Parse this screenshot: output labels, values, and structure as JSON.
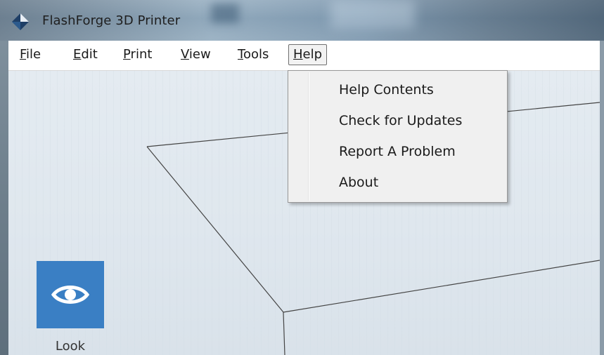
{
  "window": {
    "title": "FlashForge 3D Printer",
    "app_icon": "flashforge-logo-icon"
  },
  "menubar": {
    "items": [
      {
        "mnemonic": "F",
        "rest": "ile"
      },
      {
        "mnemonic": "E",
        "rest": "dit"
      },
      {
        "mnemonic": "P",
        "rest": "rint"
      },
      {
        "mnemonic": "V",
        "rest": "iew"
      },
      {
        "mnemonic": "T",
        "rest": "ools"
      },
      {
        "mnemonic": "H",
        "rest": "elp"
      }
    ],
    "active": "Help"
  },
  "help_menu": {
    "items": [
      "Help Contents",
      "Check for Updates",
      "Report A Problem",
      "About"
    ]
  },
  "toolbar": {
    "look_label": "Look",
    "look_icon": "eye-icon",
    "accent": "#3a7fc4"
  }
}
